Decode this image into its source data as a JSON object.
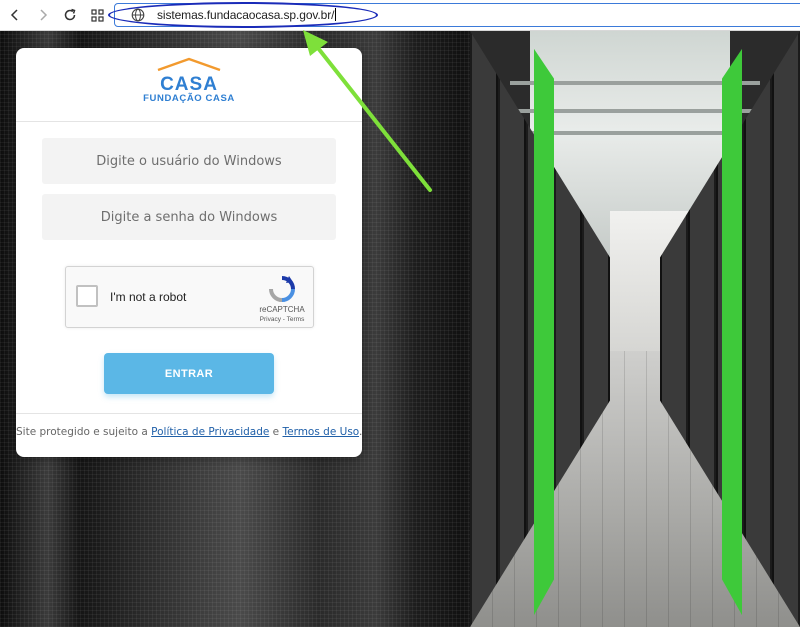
{
  "browser": {
    "url": "sistemas.fundacaocasa.sp.gov.br/"
  },
  "logo": {
    "word": "CASA",
    "subtitle": "FUNDAÇÃO CASA"
  },
  "login": {
    "username_placeholder": "Digite o usuário do Windows",
    "password_placeholder": "Digite a senha do Windows",
    "submit_label": "ENTRAR"
  },
  "captcha": {
    "label": "I'm not a robot",
    "brand": "reCAPTCHA",
    "privacy": "Privacy",
    "separator": " - ",
    "terms": "Terms"
  },
  "footer": {
    "prefix": "Site protegido e sujeito a ",
    "privacy_link": "Política de Privacidade",
    "conjunction": " e ",
    "terms_link": "Termos de Uso",
    "suffix": "."
  },
  "colors": {
    "brand_blue": "#2f7fd2",
    "logo_orange": "#f29a2e",
    "button": "#5bb7e6",
    "annotation_arrow": "#7ee03a",
    "annotation_ellipse": "#1a2bb8"
  }
}
